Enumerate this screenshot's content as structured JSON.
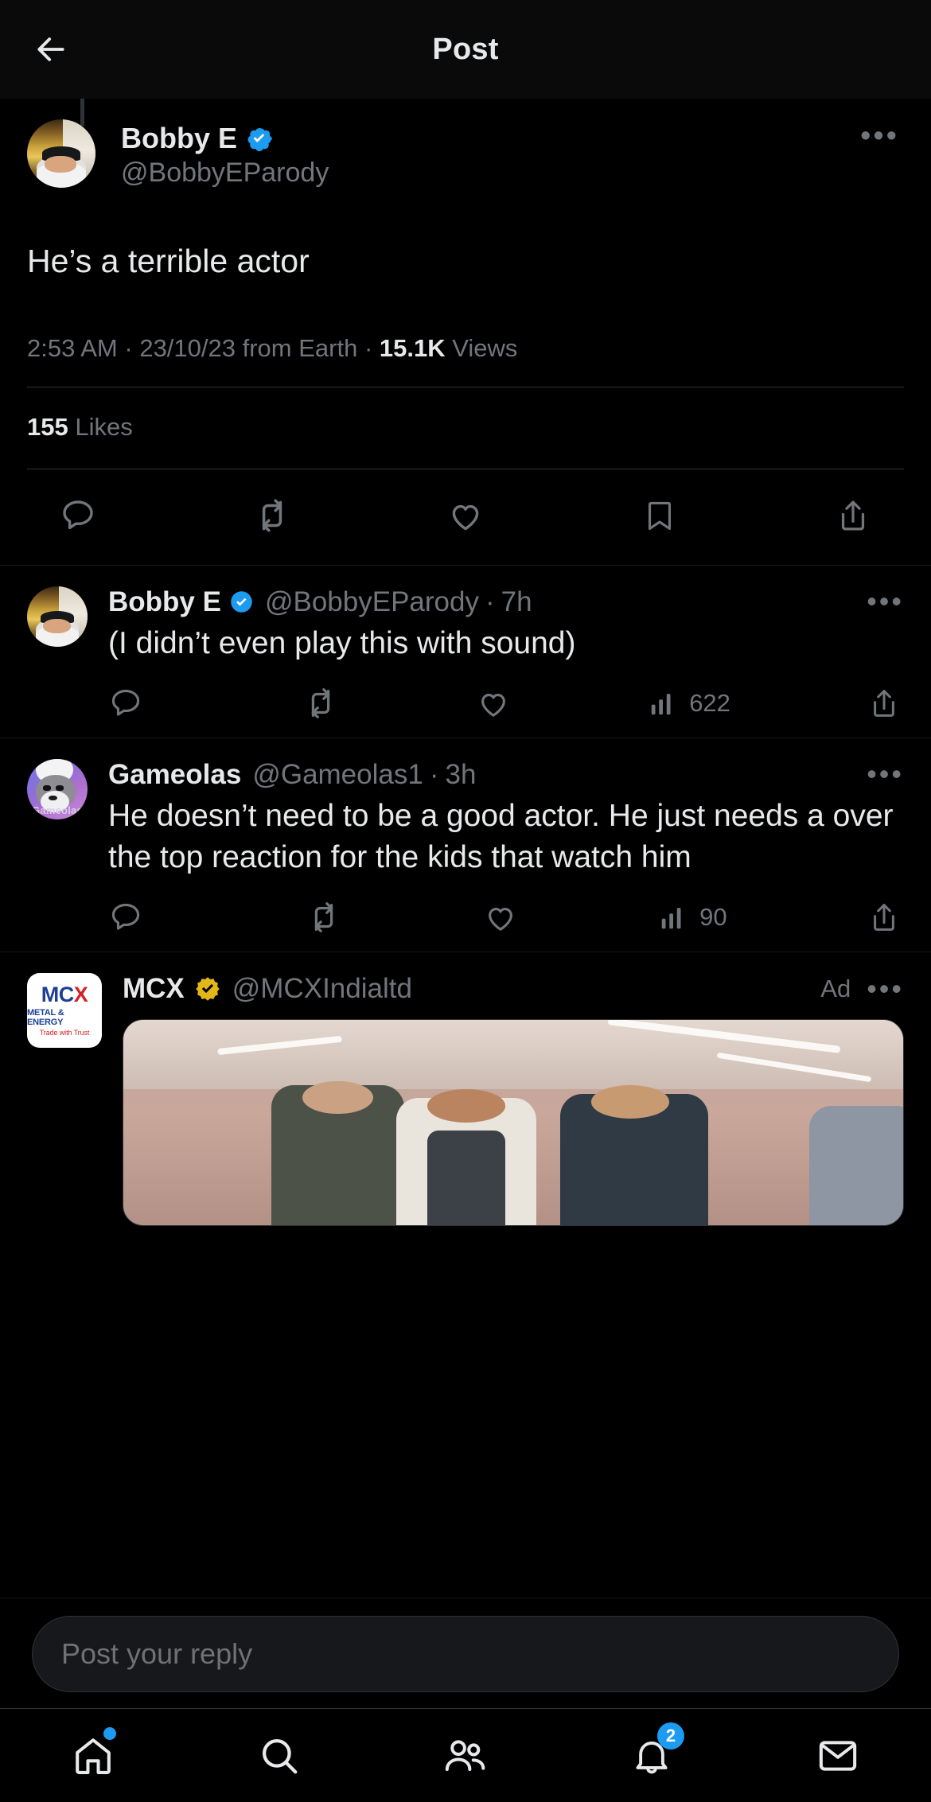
{
  "header": {
    "title": "Post",
    "back_icon": "arrow-left-icon"
  },
  "main_post": {
    "display_name": "Bobby E",
    "handle": "@BobbyEParody",
    "verified": true,
    "verified_type": "blue",
    "text": "He’s a terrible actor",
    "time": "2:53 AM",
    "separator": "·",
    "date": "23/10/23",
    "source": "from Earth",
    "views_count": "15.1K",
    "views_label": "Views",
    "likes_count": "155",
    "likes_label": "Likes",
    "more_icon": "more-horizontal-icon",
    "actions": [
      {
        "name": "reply-icon",
        "label": "Reply"
      },
      {
        "name": "retweet-icon",
        "label": "Repost"
      },
      {
        "name": "like-icon",
        "label": "Like"
      },
      {
        "name": "bookmark-icon",
        "label": "Bookmark"
      },
      {
        "name": "share-icon",
        "label": "Share"
      }
    ]
  },
  "replies": [
    {
      "display_name": "Bobby E",
      "handle": "@BobbyEParody",
      "verified": true,
      "verified_type": "blue",
      "time": "7h",
      "text": "(I didn’t even play this with sound)",
      "views": "622",
      "avatar": "bobby-avatar"
    },
    {
      "display_name": "Gameolas",
      "handle": "@Gameolas1",
      "verified": false,
      "verified_type": "none",
      "time": "3h",
      "text": "He doesn’t need to be a good actor. He just needs a over the top reaction for the kids that watch him",
      "views": "90",
      "avatar": "gameolas-avatar",
      "avatar_label": "Gameolas"
    }
  ],
  "ad": {
    "display_name": "MCX",
    "handle": "@MCXIndialtd",
    "verified": true,
    "verified_type": "gold",
    "label": "Ad",
    "more_icon": "more-horizontal-icon",
    "logo": {
      "brand_mc": "MC",
      "brand_x": "X",
      "tagline1": "METAL & ENERGY",
      "tagline2": "Trade with Trust"
    },
    "media_type": "video-thumbnail"
  },
  "composer": {
    "placeholder": "Post your reply",
    "value": ""
  },
  "nav": {
    "items": [
      {
        "name": "home-icon",
        "label": "Home",
        "dot": true,
        "badge": ""
      },
      {
        "name": "search-icon",
        "label": "Search",
        "dot": false,
        "badge": ""
      },
      {
        "name": "communities-icon",
        "label": "Communities",
        "dot": false,
        "badge": ""
      },
      {
        "name": "notifications-icon",
        "label": "Notifications",
        "dot": false,
        "badge": "2"
      },
      {
        "name": "messages-icon",
        "label": "Messages",
        "dot": false,
        "badge": ""
      }
    ],
    "notifications_badge": "2"
  },
  "colors": {
    "accent": "#1d9bf0",
    "gold": "#e2b719",
    "muted": "#71767b",
    "text": "#e7e9ea",
    "border": "#2f3336",
    "background": "#000000"
  }
}
